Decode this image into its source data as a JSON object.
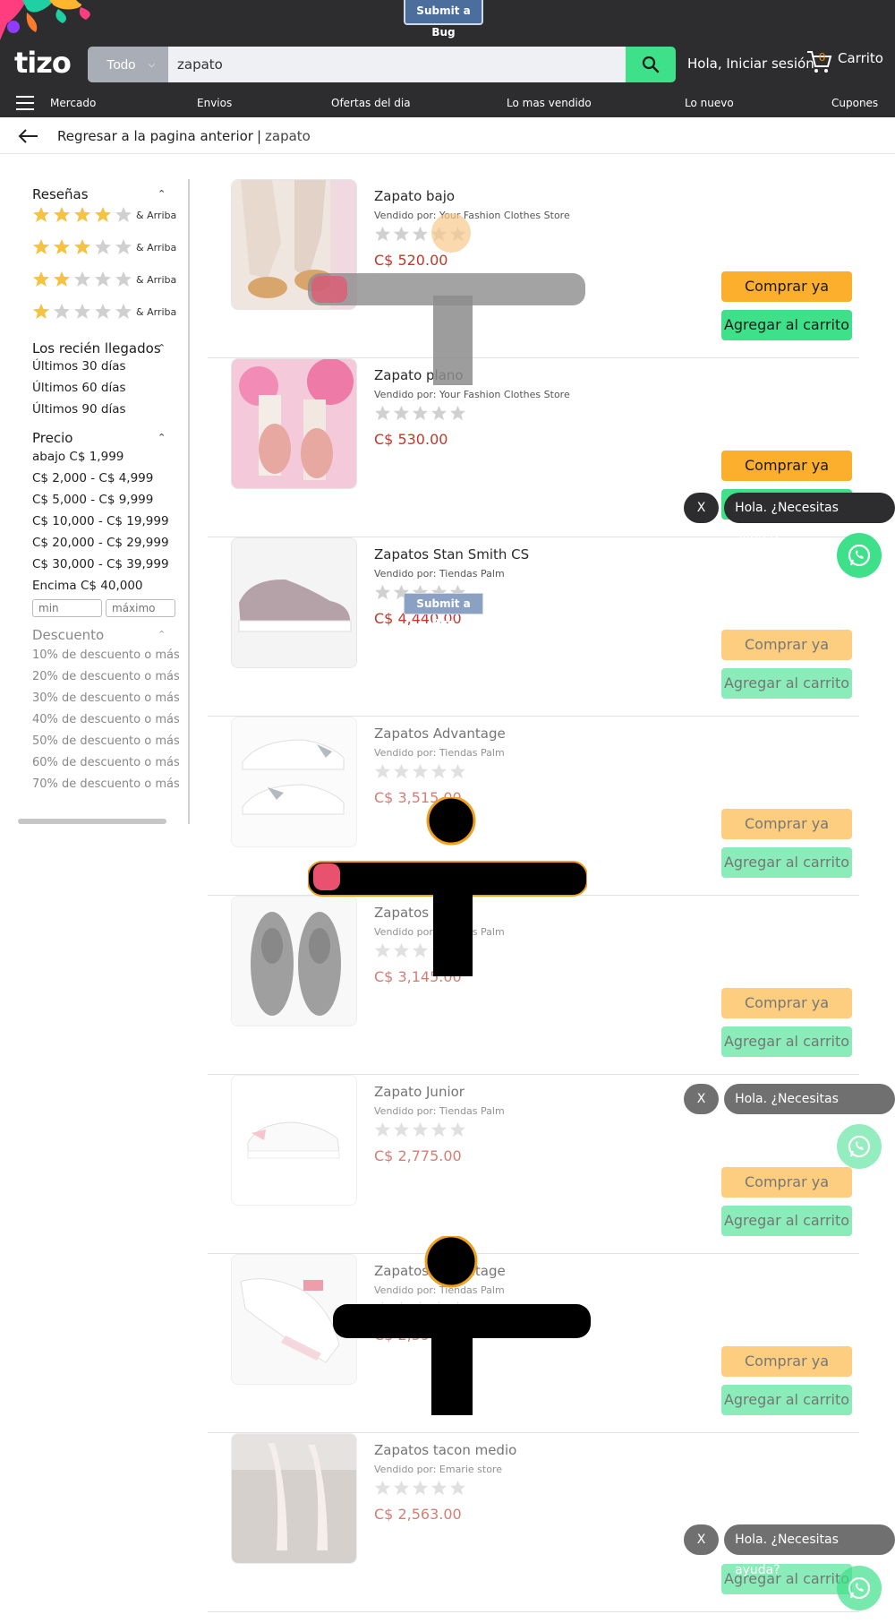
{
  "header": {
    "bug_button": "Submit a Bug",
    "logo_text": "tizo",
    "search": {
      "category": "Todo",
      "value": "zapato"
    },
    "signin": "Hola, Iniciar sesión",
    "cart": {
      "count": "0",
      "label": "Carrito"
    },
    "nav": [
      "Mercado",
      "Envios",
      "Ofertas del dia",
      "Lo mas vendido",
      "Lo nuevo",
      "Cupones"
    ]
  },
  "breadcrumb": {
    "back": "Regresar a la pagina anterior",
    "separator": "|",
    "query": "zapato"
  },
  "sidebar": {
    "reviews_title": "Reseñas",
    "reviews": [
      {
        "stars": 4,
        "label": "& Arriba"
      },
      {
        "stars": 3,
        "label": "& Arriba"
      },
      {
        "stars": 2,
        "label": "& Arriba"
      },
      {
        "stars": 1,
        "label": "& Arriba"
      }
    ],
    "new_title": "Los recién llegados",
    "new_items": [
      "Últimos 30 días",
      "Últimos 60 días",
      "Últimos 90 días"
    ],
    "price_title": "Precio",
    "price_items": [
      "abajo C$ 1,999",
      "C$ 2,000 - C$ 4,999",
      "C$ 5,000 - C$ 9,999",
      "C$ 10,000 - C$ 19,999",
      "C$ 20,000 - C$ 29,999",
      "C$ 30,000 - C$ 39,999",
      "Encima C$ 40,000"
    ],
    "price_min_placeholder": "min",
    "price_max_placeholder": "máximo",
    "discount_title": "Descuento",
    "discount_items": [
      "10% de descuento o más",
      "20% de descuento o más",
      "30% de descuento o más",
      "40% de descuento o más",
      "50% de descuento o más",
      "60% de descuento o más",
      "70% de descuento o más"
    ]
  },
  "products": [
    {
      "name": "Zapato bajo",
      "seller": "Vendido por: Your Fashion Clothes Store",
      "price": "C$ 520.00"
    },
    {
      "name": "Zapato plano",
      "seller": "Vendido por: Your Fashion Clothes Store",
      "price": "C$ 530.00"
    },
    {
      "name": "Zapatos Stan Smith CS",
      "seller": "Vendido por: Tiendas Palm",
      "price": "C$ 4,440.00"
    },
    {
      "name": "Zapatos Advantage",
      "seller": "Vendido por: Tiendas Palm",
      "price": "C$ 3,515.00"
    },
    {
      "name": "Zapatos",
      "seller": "Vendido por: Tiendas Palm",
      "price": "C$ 3,145.00"
    },
    {
      "name": "Zapato Junior",
      "seller": "Vendido por: Tiendas Palm",
      "price": "C$ 2,775.00"
    },
    {
      "name": "Zapatos Advantage",
      "seller": "Vendido por: Tiendas Palm",
      "price": "C$ 2,590.00"
    },
    {
      "name": "Zapatos tacon medio",
      "seller": "Vendido por: Emarie store",
      "price": "C$ 2,563.00"
    }
  ],
  "actions": {
    "buy": "Comprar ya",
    "add_to_cart": "Agregar al carrito"
  },
  "help_widget": {
    "close": "X",
    "message": "Hola. ¿Necesitas ayuda?"
  },
  "colors": {
    "header_bg": "#2d2d2f",
    "accent_green": "#3ee08a",
    "accent_orange": "#fcaf2c",
    "price_red": "#c0392b",
    "star_yellow": "#f5c242",
    "star_grey": "#d0d0d0"
  }
}
